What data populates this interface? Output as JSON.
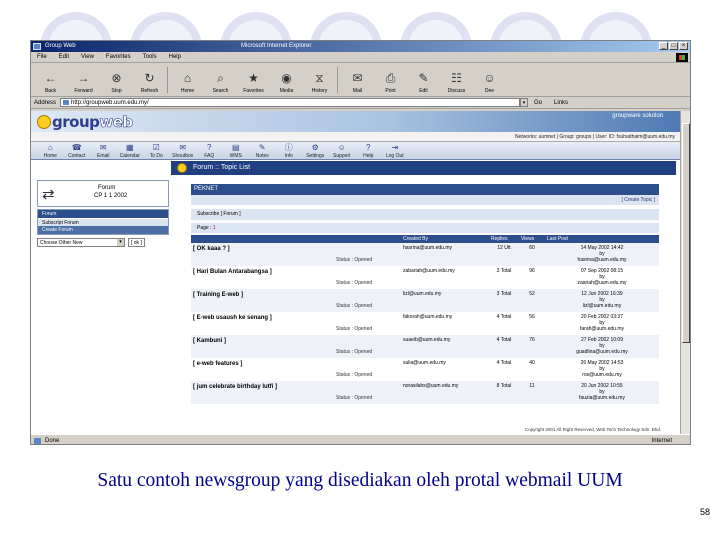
{
  "browser": {
    "window_title": "Group Web",
    "ie_title": "Microsoft Internet Explorer",
    "controls": [
      "_",
      "□",
      "×"
    ],
    "menu": [
      "File",
      "Edit",
      "View",
      "Favorites",
      "Tools",
      "Help"
    ],
    "toolbar": [
      {
        "label": "Back",
        "icon": "back-arrow-icon",
        "glyph": "←"
      },
      {
        "label": "Forward",
        "icon": "forward-arrow-icon",
        "glyph": "→"
      },
      {
        "label": "Stop",
        "icon": "stop-icon",
        "glyph": "⊗"
      },
      {
        "label": "Refresh",
        "icon": "refresh-icon",
        "glyph": "↻"
      },
      {
        "label": "Home",
        "icon": "home-icon",
        "glyph": "⌂"
      },
      {
        "label": "Search",
        "icon": "search-icon",
        "glyph": "⌕"
      },
      {
        "label": "Favorites",
        "icon": "favorites-icon",
        "glyph": "★"
      },
      {
        "label": "Media",
        "icon": "media-icon",
        "glyph": "◉"
      },
      {
        "label": "History",
        "icon": "history-icon",
        "glyph": "⧖"
      },
      {
        "label": "Mail",
        "icon": "mail-icon",
        "glyph": "✉"
      },
      {
        "label": "Print",
        "icon": "print-icon",
        "glyph": "⎙"
      },
      {
        "label": "Edit",
        "icon": "edit-icon",
        "glyph": "✎"
      },
      {
        "label": "Discuss",
        "icon": "discuss-icon",
        "glyph": "☷"
      },
      {
        "label": "Dee",
        "icon": "messenger-icon",
        "glyph": "☺"
      }
    ],
    "address_label": "Address",
    "address_value": "http://groupweb.uum.edu.my/",
    "go_label": "Go",
    "links_label": "Links",
    "status_text": "Done",
    "zone_text": "Internet"
  },
  "site": {
    "logo_group": "group",
    "logo_web": "web",
    "banner_right": "groupware solution",
    "infobar": "Networks: uumnet  |  Group: groups  |  User: ID: fsuhadhaim@uum.edu.my",
    "nav": [
      {
        "label": "Home",
        "icon": "home-icon",
        "glyph": "⌂"
      },
      {
        "label": "Contact",
        "icon": "contact-icon",
        "glyph": "☎"
      },
      {
        "label": "Email",
        "icon": "email-icon",
        "glyph": "✉"
      },
      {
        "label": "Calendar",
        "icon": "calendar-icon",
        "glyph": "▦"
      },
      {
        "label": "To Do",
        "icon": "todo-icon",
        "glyph": "☑"
      },
      {
        "label": "Shoutbox",
        "icon": "shoutbox-icon",
        "glyph": "✉"
      },
      {
        "label": "FAQ",
        "icon": "faq-icon",
        "glyph": "?"
      },
      {
        "label": "WMS",
        "icon": "wms-icon",
        "glyph": "▤"
      },
      {
        "label": "Notes",
        "icon": "notes-icon",
        "glyph": "✎"
      },
      {
        "label": "Info",
        "icon": "info-icon",
        "glyph": "ⓘ"
      },
      {
        "label": "Settings",
        "icon": "settings-icon",
        "glyph": "⚙"
      },
      {
        "label": "Support",
        "icon": "support-icon",
        "glyph": "☺"
      },
      {
        "label": "Help",
        "icon": "help-icon",
        "glyph": "?"
      },
      {
        "label": "Log Out",
        "icon": "logout-icon",
        "glyph": "⇥"
      }
    ],
    "page_heading": "Forum :: Topic List",
    "forum_box_line1": "Forum",
    "forum_box_line2": "CP 1 1 2002",
    "left_menu": {
      "header": "Forum",
      "items": [
        "Subscript Forum",
        "Create Forum"
      ],
      "select_value": "Choose Other New",
      "go_label": "[ ok ]"
    },
    "forum_name": "PEKNET",
    "forum_meta": "[ Create Topic ]",
    "subscribe_text": "Subscribe  [ Forum ]",
    "page_label": "Page :",
    "page_number": "1",
    "columns": [
      "",
      "Created By",
      "Replies",
      "Views",
      "Last Post"
    ],
    "status_label": "Status : Opened",
    "topics": [
      {
        "title": "[ OK kaaa ? ]",
        "creator": "hasrina@uum.edu.my",
        "replies": "12\nUtt",
        "views": "60",
        "last_post": "14 May 2002 14:42\nby\nhasrina@uum.edu.my"
      },
      {
        "title": "[ Hari Bulan Antarabangsa ]",
        "creator": "zabariah@uum.edu.my",
        "replies": "3 Total",
        "views": "96",
        "last_post": "07 Sep 2002 08:15\nby\nzaariah@uum.edu.my"
      },
      {
        "title": "[ Training E-web ]",
        "creator": "lizl@uum.edu.my",
        "replies": "3 Total",
        "views": "52",
        "last_post": "12 Jun 2002 16:39\nby\nlizl@uum.edu.my"
      },
      {
        "title": "[ E-web usaush ke senang ]",
        "creator": "fakorah@uum.edu.my",
        "replies": "4 Total",
        "views": "56",
        "last_post": "20 Feb 2002 03:37\nby\nfarah@uum.edu.my"
      },
      {
        "title": "[ Kambuni ]",
        "creator": "suaeib@uum.edu.my",
        "replies": "4 Total",
        "views": "76",
        "last_post": "27 Feb 2002 10:09\nby\nguadlina@uum.edu.my"
      },
      {
        "title": "[ e-web features ]",
        "creator": "sulia@uum.edu.my",
        "replies": "4 Total",
        "views": "40",
        "last_post": "26 May 2002 14:53\nby\nros@uum.edu.my"
      },
      {
        "title": "[ jum celebrate birthday lutfi ]",
        "creator": "norasilahs@uum.edu.my",
        "replies": "8 Total",
        "views": "11",
        "last_post": "20 Jun 2002 10:55\nby\nfauzia@uum.edu.my"
      }
    ],
    "copyright": "Copyright 2001 All Right Reserved, Web Tech Technology Sdn. Bhd."
  },
  "slide": {
    "caption": "Satu contoh newsgroup yang disediakan oleh protal webmail UUM",
    "page_number": "58"
  }
}
